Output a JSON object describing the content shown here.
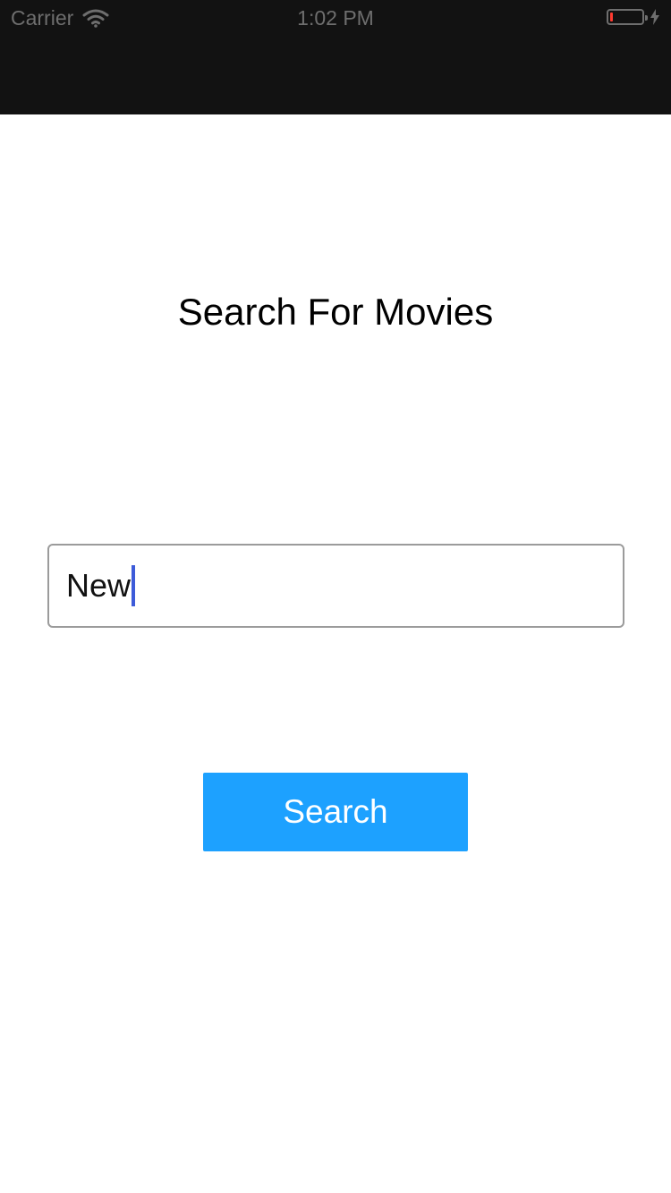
{
  "status_bar": {
    "carrier": "Carrier",
    "time": "1:02 PM",
    "wifi_icon": "wifi-icon",
    "battery_icon": "battery-icon",
    "charging_icon": "bolt-icon",
    "battery_level": 0.08
  },
  "colors": {
    "header_background": "#121212",
    "status_text": "#6e6e6e",
    "battery_low": "#ff3b30",
    "accent": "#1da1ff",
    "caret": "#3d5bd9"
  },
  "main": {
    "title": "Search For Movies",
    "search_input": {
      "value": "New",
      "placeholder": ""
    },
    "search_button_label": "Search"
  }
}
